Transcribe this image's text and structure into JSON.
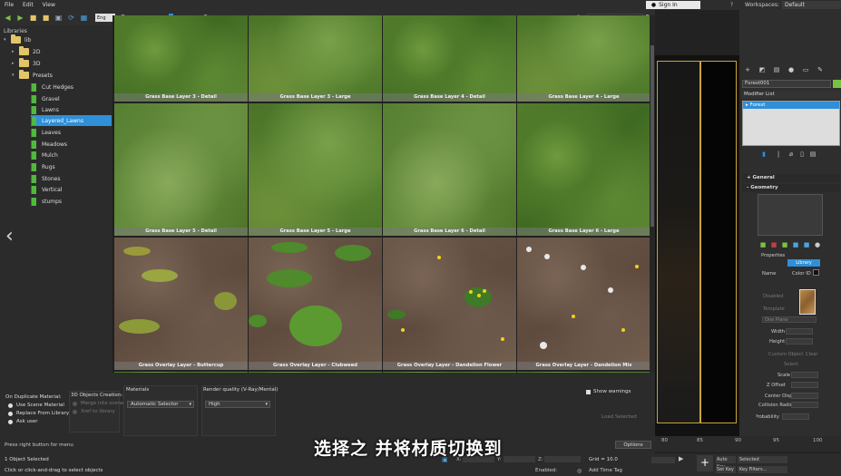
{
  "menubar": {
    "items": [
      "File",
      "Edit",
      "View"
    ]
  },
  "topright": {
    "signin": "Sign In",
    "workspaces_label": "Workspaces:",
    "workspace": "Default"
  },
  "toolbar": {
    "lang": "Eng"
  },
  "tree": {
    "header": "Libraries",
    "items": [
      {
        "label": "lib"
      },
      {
        "label": "2D"
      },
      {
        "label": "3D"
      },
      {
        "label": "Presets"
      },
      {
        "label": "Cut Hedges"
      },
      {
        "label": "Gravel"
      },
      {
        "label": "Lawns"
      },
      {
        "label": "Layered_Lawns"
      },
      {
        "label": "Leaves"
      },
      {
        "label": "Meadows"
      },
      {
        "label": "Mulch"
      },
      {
        "label": "Rugs"
      },
      {
        "label": "Stones"
      },
      {
        "label": "Vertical"
      },
      {
        "label": "stumps"
      }
    ]
  },
  "grid": {
    "labels": [
      "Grass Base Layer 3 - Detail",
      "Grass Base Layer 3 - Large",
      "Grass Base Layer 4 - Detail",
      "Grass Base Layer 4 - Large",
      "Grass Base Layer 5 - Detail",
      "Grass Base Layer 5 - Large",
      "Grass Base Layer 6 - Detail",
      "Grass Base Layer 6 - Large",
      "Grass Overlay Layer - Buttercup",
      "Grass Overlay Layer - Clubweed",
      "Grass Overlay Layer - Dandelion Flower",
      "Grass Overlay Layer - Dandelion Mix"
    ]
  },
  "options": {
    "duplicate_label": "On Duplicate Material:",
    "dup_opts": [
      "Use Scene Material",
      "Replace From Library",
      "Ask user"
    ],
    "objects_label": "3D Objects Creation:",
    "obj_opts": [
      "Merge into scene",
      "Xref to library"
    ],
    "materials_label": "Materials",
    "materials_value": "Automatic Selector",
    "render_label": "Render quality (V-Ray/Mental)",
    "render_value": "High",
    "show_warnings": "Show warnings",
    "load_selected": "Load Selected",
    "options_btn": "Options",
    "press_right": "Press right button for menu"
  },
  "command_panel": {
    "object_name": "Forest001",
    "modifier_list": "Modifier List",
    "stack_item": "Forest",
    "general": "General",
    "geometry": "Geometry",
    "properties": "Properties",
    "library": "Library",
    "name": "Name",
    "color_id": "Color ID",
    "disabled": "Disabled",
    "template": "Template",
    "one_plane": "One Plane",
    "width": "Width",
    "height": "Height",
    "custom_object": "Custom Object",
    "clear": "Clear",
    "select": "Select",
    "scale": "Scale",
    "z_offset": "Z Offset",
    "center_displ": "Center Displ.",
    "collision_radius": "Collision Radius",
    "probability": "Probability"
  },
  "timeline": {
    "ticks": [
      "80",
      "85",
      "90",
      "95",
      "100"
    ]
  },
  "status": {
    "selected": "1 Object Selected",
    "hint": "Click or click-and-drag to select objects",
    "grid": "Grid = 10.0",
    "add_time_tag": "Add Time Tag",
    "enabled": "Enabled:",
    "auto_key": "Auto Key",
    "selected_dd": "Selected",
    "set_key": "Set Key",
    "key_filters": "Key Filters..."
  },
  "subtitle": "选择之 并将材质切换到",
  "colors": {
    "accent": "#2f8fd8",
    "folder": "#e2c56a",
    "book": "#4fba3c",
    "frame": "#c9a43a"
  }
}
